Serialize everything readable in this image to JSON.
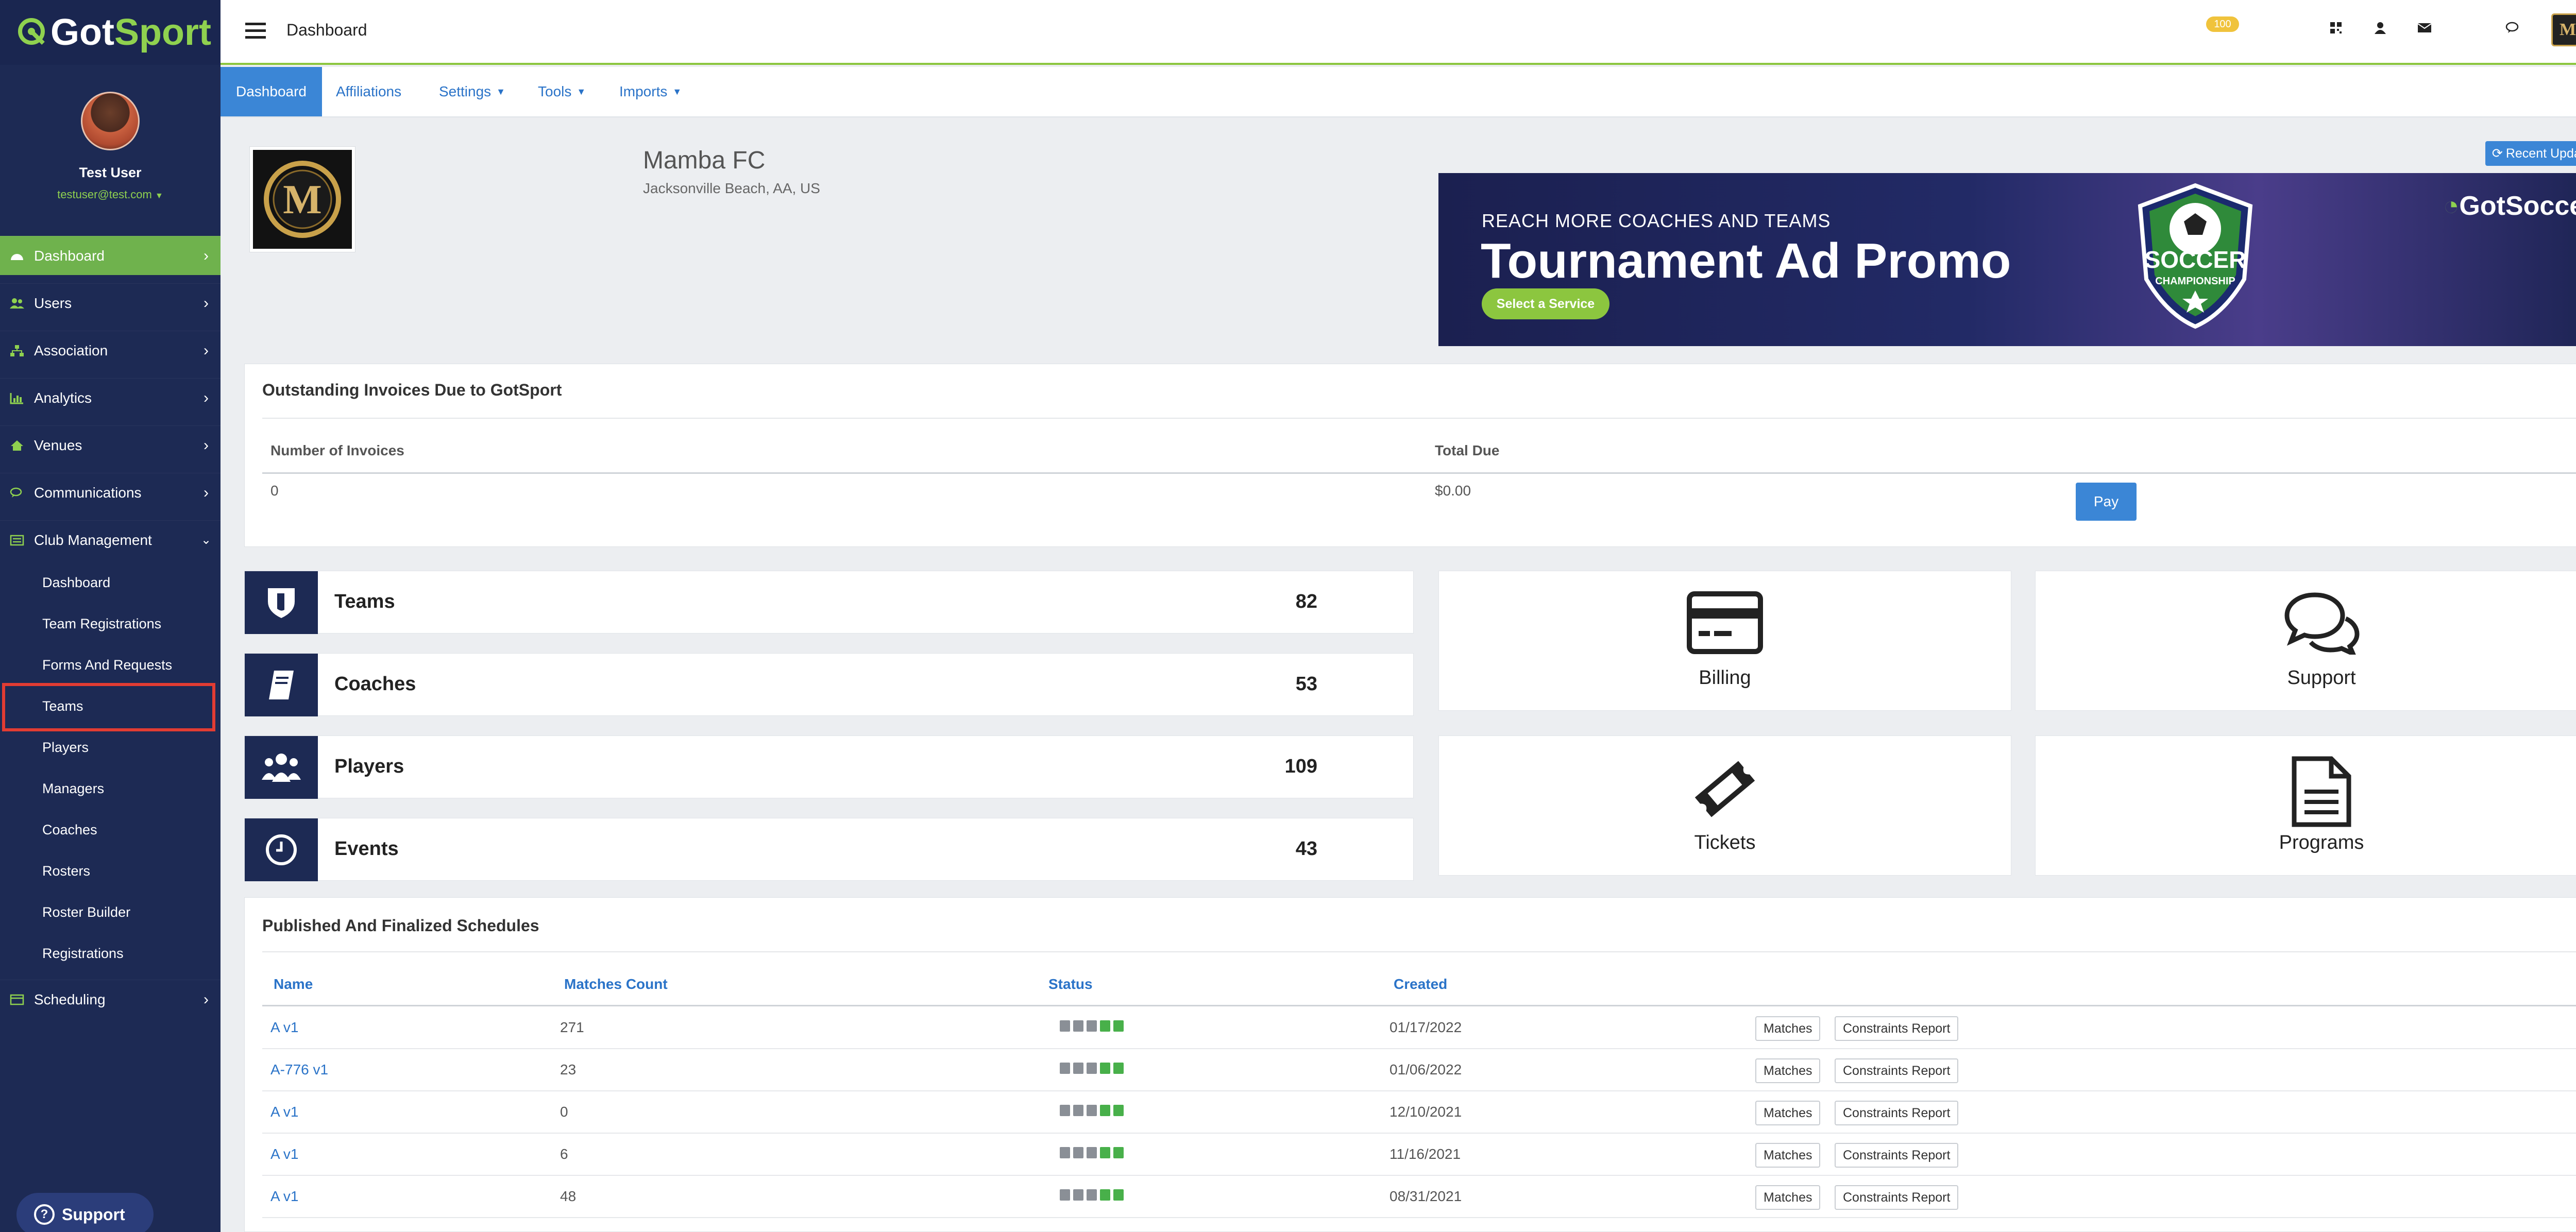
{
  "brand": {
    "logo_text": "GotSport",
    "logo_text_pre": "Got",
    "logo_text_post": "Sport"
  },
  "profile": {
    "name": "Test User",
    "email": "testuser@test.com"
  },
  "sidebar": {
    "items": [
      {
        "label": "Dashboard",
        "icon": "dashboard-icon"
      },
      {
        "label": "Users",
        "icon": "users-icon"
      },
      {
        "label": "Association",
        "icon": "sitemap-icon"
      },
      {
        "label": "Analytics",
        "icon": "chart-icon"
      },
      {
        "label": "Venues",
        "icon": "home-icon"
      },
      {
        "label": "Communications",
        "icon": "comments-icon"
      },
      {
        "label": "Club Management",
        "icon": "list-icon"
      },
      {
        "label": "Scheduling",
        "icon": "calendar-icon"
      }
    ],
    "club_sub": [
      "Dashboard",
      "Team Registrations",
      "Forms And Requests",
      "Teams",
      "Players",
      "Managers",
      "Coaches",
      "Rosters",
      "Roster Builder",
      "Registrations"
    ],
    "support_label": "Support"
  },
  "topbar": {
    "title": "Dashboard",
    "mail_badge": "100"
  },
  "tabs": [
    {
      "label": "Dashboard",
      "dropdown": false
    },
    {
      "label": "Affiliations",
      "dropdown": false
    },
    {
      "label": "Settings",
      "dropdown": true
    },
    {
      "label": "Tools",
      "dropdown": true
    },
    {
      "label": "Imports",
      "dropdown": true
    }
  ],
  "club": {
    "name": "Mamba FC",
    "location": "Jacksonville Beach, AA, US",
    "logo_letter": "M"
  },
  "recent_updates": "Recent Updates",
  "banner": {
    "line1": "REACH MORE COACHES AND TEAMS",
    "line2": "Tournament Ad Promo",
    "button": "Select a Service",
    "shield_top": "SOCCER",
    "shield_bottom": "CHAMPIONSHIP",
    "brand": "GotSoccer"
  },
  "invoices": {
    "title": "Outstanding Invoices Due to GotSport",
    "col_count": "Number of Invoices",
    "col_total": "Total Due",
    "count": "0",
    "total": "$0.00",
    "pay": "Pay"
  },
  "stats": [
    {
      "label": "Teams",
      "value": "82"
    },
    {
      "label": "Coaches",
      "value": "53"
    },
    {
      "label": "Players",
      "value": "109"
    },
    {
      "label": "Events",
      "value": "43"
    }
  ],
  "tiles": [
    {
      "label": "Billing",
      "icon": "credit-card-icon"
    },
    {
      "label": "Support",
      "icon": "comments-icon"
    },
    {
      "label": "Tickets",
      "icon": "ticket-icon"
    },
    {
      "label": "Programs",
      "icon": "document-icon"
    }
  ],
  "schedules": {
    "title": "Published And Finalized Schedules",
    "headers": [
      "Name",
      "Matches Count",
      "Status",
      "Created"
    ],
    "matches_btn": "Matches",
    "constraints_btn": "Constraints Report",
    "rows": [
      {
        "name": "A v1",
        "count": "271",
        "created": "01/17/2022"
      },
      {
        "name": "A-776 v1",
        "count": "23",
        "created": "01/06/2022"
      },
      {
        "name": "A v1",
        "count": "0",
        "created": "12/10/2021"
      },
      {
        "name": "A v1",
        "count": "6",
        "created": "11/16/2021"
      },
      {
        "name": "A v1",
        "count": "48",
        "created": "08/31/2021"
      }
    ]
  }
}
